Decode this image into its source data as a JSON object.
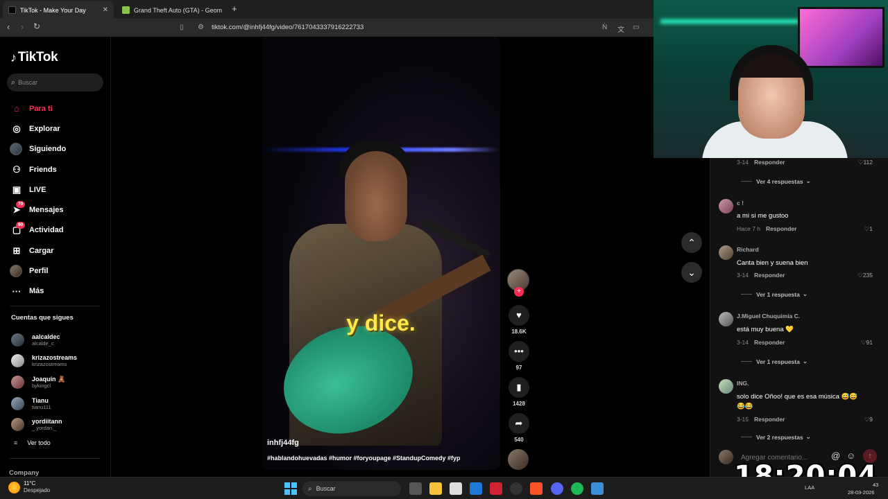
{
  "browser": {
    "tabs": [
      {
        "title": "TikTok - Make Your Day",
        "active": true
      },
      {
        "title": "Grand Theft Auto (GTA) - Geometry D",
        "active": false
      }
    ],
    "url": "tiktok.com/@inhfj44fg/video/7617043337916222733"
  },
  "sidebar": {
    "logo": "TikTok",
    "search_placeholder": "Buscar",
    "nav": [
      {
        "label": "Para ti",
        "icon": "home-icon",
        "active": true
      },
      {
        "label": "Explorar",
        "icon": "compass-icon"
      },
      {
        "label": "Siguiendo",
        "icon": "avatar-icon"
      },
      {
        "label": "Friends",
        "icon": "friends-icon"
      },
      {
        "label": "LIVE",
        "icon": "live-icon"
      },
      {
        "label": "Mensajes",
        "icon": "messages-icon",
        "badge": "70"
      },
      {
        "label": "Actividad",
        "icon": "activity-icon",
        "badge": "90"
      },
      {
        "label": "Cargar",
        "icon": "upload-icon"
      },
      {
        "label": "Perfil",
        "icon": "profile-icon"
      },
      {
        "label": "Más",
        "icon": "more-icon"
      }
    ],
    "following_title": "Cuentas que sigues",
    "following": [
      {
        "name": "aalcaldec",
        "handle": "alcalde_c"
      },
      {
        "name": "krizazostreams",
        "handle": "krizazostreams"
      },
      {
        "name": "Joaquín 🧸",
        "handle": "bykingcl"
      },
      {
        "name": "Tianu",
        "handle": "tianu111"
      },
      {
        "name": "yordiitann",
        "handle": "_.yordan._"
      }
    ],
    "see_all": "Ver todo",
    "company": "Company"
  },
  "video": {
    "caption_overlay": "y dice.",
    "author": "inhfj44fg",
    "tags": "#hablandohuevadas #humor #foryoupage #StandupComedy #fyp"
  },
  "actions": {
    "likes": "18.6K",
    "comments": "97",
    "saves": "1428",
    "shares": "540"
  },
  "comments": {
    "top": {
      "date": "3-14",
      "reply": "Responder",
      "likes": "112",
      "more": "Ver 4 respuestas"
    },
    "items": [
      {
        "user": "c !",
        "text": "a mi si me gustoo",
        "date": "Hace 7 h",
        "reply": "Responder",
        "likes": "1",
        "more": ""
      },
      {
        "user": "Richard",
        "text": "Canta bien y suena bien",
        "date": "3-14",
        "reply": "Responder",
        "likes": "235",
        "more": "Ver 1 respuesta"
      },
      {
        "user": "J.Miguel Chuquimia C.",
        "text": "está muy buena 💛",
        "date": "3-14",
        "reply": "Responder",
        "likes": "91",
        "more": "Ver 1 respuesta"
      },
      {
        "user": "ING.",
        "text": "solo dice Oñoo! que es esa música 😅😅",
        "text2": "😂😂",
        "date": "3-15",
        "reply": "Responder",
        "likes": "9",
        "more": "Ver 2 respuestas"
      }
    ],
    "input_placeholder": "Agregar comentario..."
  },
  "overlay_clock": "18:20:04",
  "taskbar": {
    "weather_temp": "11°C",
    "weather_desc": "Despejado",
    "search": "Buscar",
    "lang": "LAA",
    "time_partial": "43",
    "date": "28-03-2026"
  }
}
